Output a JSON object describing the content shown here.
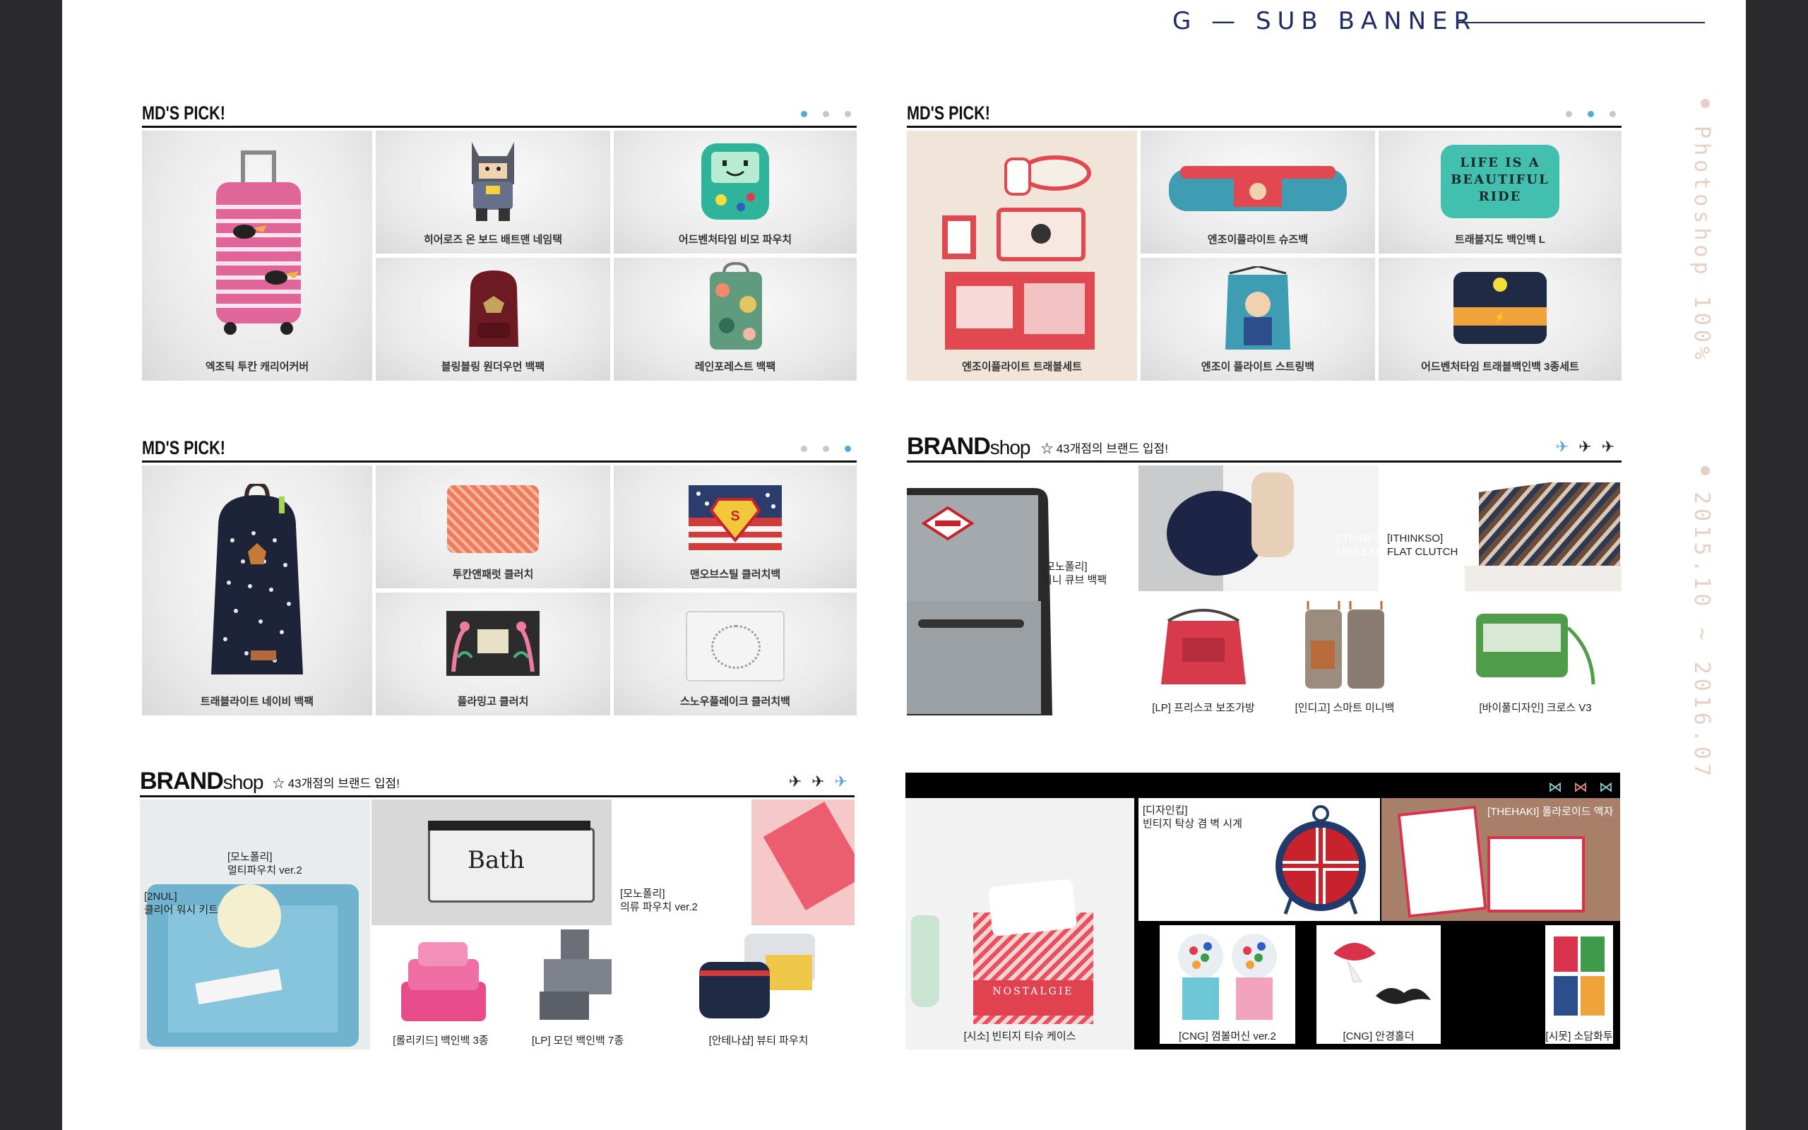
{
  "page": {
    "title": "G — SUB BANNER",
    "side_label_1": "Photoshop 100%",
    "side_label_2": "2015.10 ~ 2016.07"
  },
  "banner1": {
    "title": "MD'S PICK!",
    "active_dot": 1,
    "items": [
      {
        "label": "엑조틱 투칸 캐리어커버",
        "icon": "pink-suitcase",
        "color": "#e0669a"
      },
      {
        "label": "히어로즈 온 보드 배트맨 네임택",
        "icon": "batman-tag",
        "color": "#555a66"
      },
      {
        "label": "어드벤처타임 비모 파우치",
        "icon": "bmo-pouch",
        "color": "#2fb39b"
      },
      {
        "label": "블링블링 원더우먼 백팩",
        "icon": "maroon-backpack",
        "color": "#6e1a22"
      },
      {
        "label": "레인포레스트 백팩",
        "icon": "floral-backpack",
        "color": "#5f9b7c"
      }
    ]
  },
  "banner2": {
    "title": "MD'S PICK!",
    "active_dot": 2,
    "items": [
      {
        "label": "엔조이플라이트 트래블세트",
        "icon": "travel-set",
        "color": "#e24a55"
      },
      {
        "label": "엔조이플라이트 슈즈백",
        "icon": "shoes-bag",
        "color": "#e2484f"
      },
      {
        "label": "트래블지도 백인백 L",
        "icon": "bag-in-bag",
        "color": "#43bfb0"
      },
      {
        "label": "엔조이 플라이트 스트링백",
        "icon": "string-bag",
        "color": "#3f9db3"
      },
      {
        "label": "어드벤처타임 트래블백인백 3종세트",
        "icon": "navy-pouch",
        "color": "#1f2a44"
      }
    ],
    "tag_text": "LIFE IS A\nBEAUTIFUL\nRIDE"
  },
  "banner3": {
    "title": "MD'S PICK!",
    "active_dot": 3,
    "items": [
      {
        "label": "트래블라이트 네이비 백팩",
        "icon": "navy-backpack",
        "color": "#1d2338"
      },
      {
        "label": "투칸앤패럿 클러치",
        "icon": "orange-clutch",
        "color": "#ef7b5d"
      },
      {
        "label": "맨오브스틸 클러치백",
        "icon": "superman-clutch",
        "color": "#2b3d6d"
      },
      {
        "label": "플라밍고 클러치",
        "icon": "flamingo-clutch",
        "color": "#2c2c2c"
      },
      {
        "label": "스노우플레이크 클러치백",
        "icon": "white-clutch",
        "color": "#dcdcdc"
      }
    ]
  },
  "banner4": {
    "brand_bold": "BRAND",
    "brand_light": "shop",
    "star_text": "☆ 43개점의 브랜드 입점!",
    "active_plane": 1,
    "texts": {
      "mini_cube": "[모노폴리]\n미니 큐브 백팩",
      "earth_bag": "[ITHINKSO]\nMINI EARTH BAG",
      "flat_clutch": "[ITHINKSO]\nFLAT CLUTCH"
    },
    "captions": [
      "[LP] 프리스코 보조가방",
      "[인디고] 스마트 미니백",
      "[바이풀디자인] 크로스 V3"
    ]
  },
  "banner5": {
    "brand_bold": "BRAND",
    "brand_light": "shop",
    "star_text": "☆ 43개점의 브랜드 입점!",
    "active_plane": 3,
    "texts": {
      "multi_pouch": "[모노폴리]\n멀티파우치 ver.2",
      "wash_kit": "[2NUL]\n클리어 워시 키트",
      "clothes_pouch": "[모노폴리]\n의류 파우치 ver.2",
      "bath_label": "Bath"
    },
    "captions": [
      "[롤리키드] 백인백 3종",
      "[LP] 모던 백인백 7종",
      "[안테나샵] 뷰티 파우치"
    ]
  },
  "banner6": {
    "bow_active": 2,
    "texts": {
      "clock": "[디자인킵]\n빈티지 탁상 겸 벽 시계",
      "frame": "[THEHAKI] 폴라로이드 액자",
      "nostalgie": "NOSTALGIE"
    },
    "captions": [
      "[시소] 빈티지 티슈 케이스",
      "[CNG] 껌볼머신 ver.2",
      "[CNG] 안경홀더",
      "[시못] 소담화투"
    ]
  }
}
